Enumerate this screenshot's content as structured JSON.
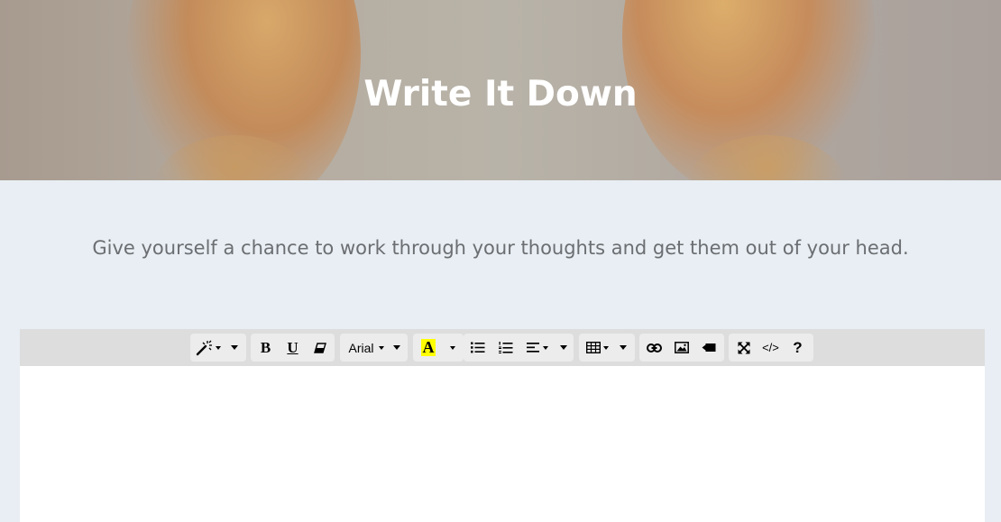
{
  "hero": {
    "title": "Write It Down"
  },
  "intro": {
    "text": "Give yourself a chance to work through your thoughts and get them out of your head."
  },
  "toolbar": {
    "font_name": "Arial",
    "bold_label": "B",
    "underline_label": "U",
    "codeview_label": "</>",
    "help_label": "?",
    "highlight_label": "A",
    "highlight_color": "#ffff00",
    "icons": [
      "magic-wand-icon",
      "bold-icon",
      "underline-icon",
      "eraser-icon",
      "text-color-icon",
      "unordered-list-icon",
      "ordered-list-icon",
      "align-left-icon",
      "table-icon",
      "link-icon",
      "image-icon",
      "video-icon",
      "fullscreen-icon",
      "code-view-icon",
      "help-icon"
    ]
  },
  "editor": {
    "content": ""
  }
}
